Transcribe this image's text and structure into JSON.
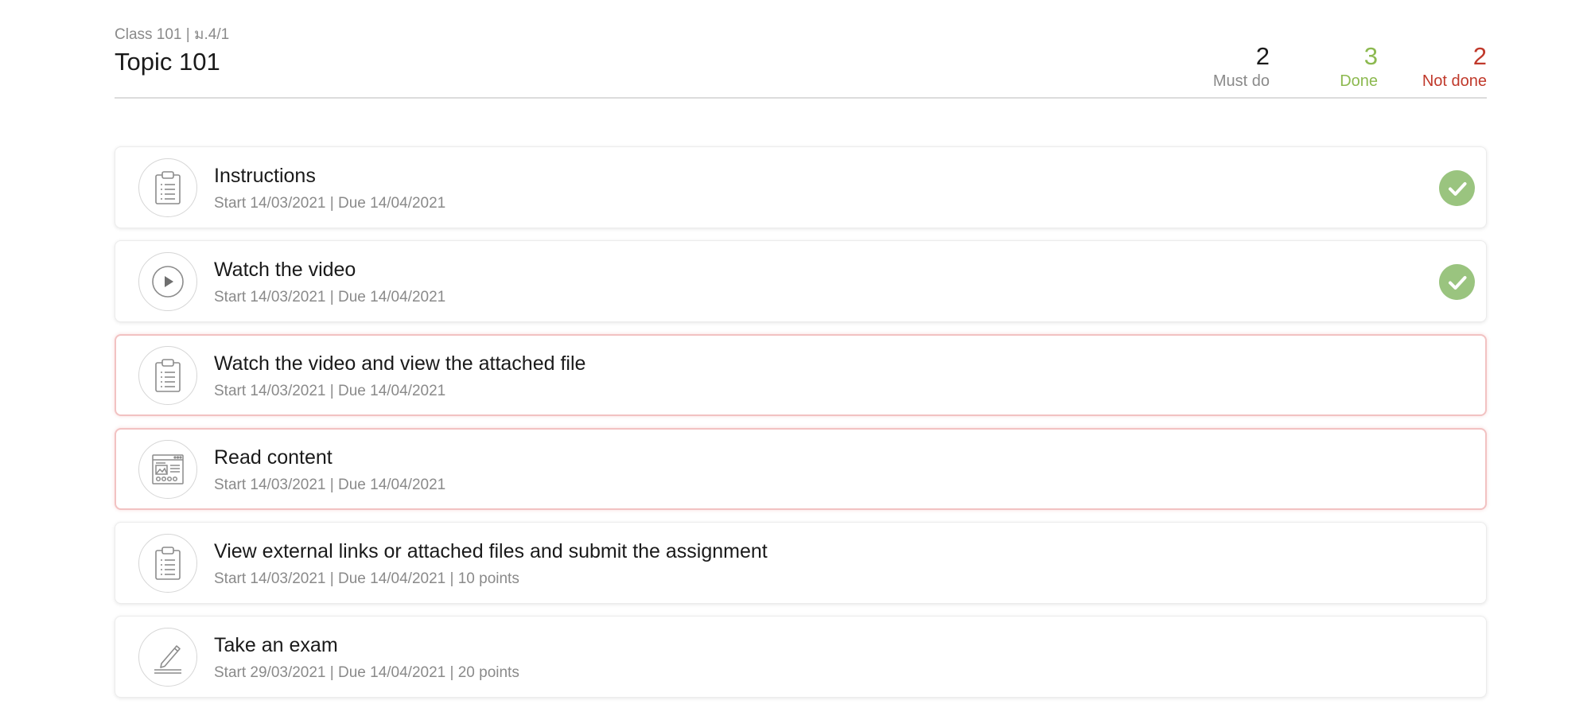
{
  "header": {
    "breadcrumb": "Class 101 | ม.4/1",
    "title": "Topic 101"
  },
  "stats": {
    "must_do": {
      "value": "2",
      "label": "Must do"
    },
    "done": {
      "value": "3",
      "label": "Done"
    },
    "not_done": {
      "value": "2",
      "label": "Not done"
    }
  },
  "colors": {
    "done": "#8cb94f",
    "not_done": "#c0392b",
    "check": "#9ac47f"
  },
  "items": [
    {
      "title": "Instructions",
      "meta": "Start 14/03/2021 | Due 14/04/2021",
      "icon": "clipboard-icon",
      "status": "done"
    },
    {
      "title": "Watch the video",
      "meta": "Start 14/03/2021 | Due 14/04/2021",
      "icon": "play-icon",
      "status": "done"
    },
    {
      "title": "Watch the video and view the attached file",
      "meta": "Start 14/03/2021 | Due 14/04/2021",
      "icon": "clipboard-icon",
      "status": "not-done"
    },
    {
      "title": "Read content",
      "meta": "Start 14/03/2021 | Due 14/04/2021",
      "icon": "webpage-icon",
      "status": "not-done"
    },
    {
      "title": "View external links or attached files and submit the assignment",
      "meta": "Start 14/03/2021 | Due 14/04/2021 | 10 points",
      "icon": "clipboard-icon",
      "status": "pending"
    },
    {
      "title": "Take an exam",
      "meta": "Start 29/03/2021 | Due 14/04/2021 | 20 points",
      "icon": "pencil-icon",
      "status": "pending"
    }
  ]
}
